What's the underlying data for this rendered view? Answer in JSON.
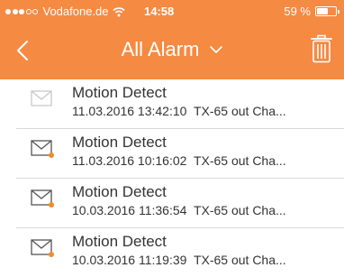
{
  "colors": {
    "accent": "#f58a42",
    "badge": "#f28c28",
    "text": "#333333"
  },
  "status_bar": {
    "carrier": "Vodafone.de",
    "time": "14:58",
    "battery_percent": "59 %",
    "battery_level": 0.59,
    "signal_bars_filled": 3,
    "signal_bars_total": 5
  },
  "nav": {
    "back_icon": "chevron-left-icon",
    "title": "All Alarm",
    "dropdown_icon": "chevron-down-icon",
    "delete_icon": "trash-icon"
  },
  "alarms": [
    {
      "title": "Motion Detect",
      "datetime": "11.03.2016 13:42:10",
      "source": "TX-65 out Cha...",
      "unread": false
    },
    {
      "title": "Motion Detect",
      "datetime": "11.03.2016 10:16:02",
      "source": "TX-65 out Cha...",
      "unread": true
    },
    {
      "title": "Motion Detect",
      "datetime": "10.03.2016 11:36:54",
      "source": "TX-65 out Cha...",
      "unread": true
    },
    {
      "title": "Motion Detect",
      "datetime": "10.03.2016 11:19:39",
      "source": "TX-65 out Cha...",
      "unread": true
    }
  ]
}
